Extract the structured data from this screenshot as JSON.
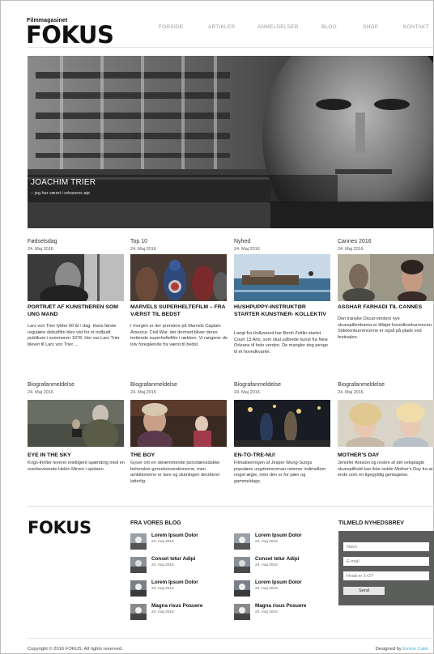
{
  "header": {
    "logo_small": "Filmmagasinet",
    "logo_big": "FOKUS",
    "nav": [
      "FORSIDE",
      "ARTIKLER",
      "ANMELDELSER",
      "BLOG",
      "SHOP",
      "KONTAKT"
    ]
  },
  "hero": {
    "title": "JOACHIM TRIER",
    "subtitle": "– jeg har været i orkanens øje"
  },
  "articles_row1": [
    {
      "category": "Fødselsdag",
      "date": "24. Maj 2016",
      "title": "PORTRÆT AF KUNSTNEREN SOM UNG MAND",
      "text": "Lars von Trier fylder 60 år i dag. Hans første regulære debutfilm blev vist for et indbudt publikum i sommeren 1978. Her var Lars Trier blevet til Lars von Trier ..."
    },
    {
      "category": "Top 10",
      "date": "24. Maj 2016",
      "title": "MARVELS SUPERHELTEFILM – FRA VÆRST TIL BEDST",
      "text": "I morgen er der premiere på Marvels Captain America: Civil War, der dermed bliver deres trettende superheltefilm i rækken. Vi rangerer de tolv foregående fra værst til bedst."
    },
    {
      "category": "Nyhed",
      "date": "24. Maj 2016",
      "title": "HUSHPUPPY-INSTRUKTØR STARTER KUNSTNER- KOLLEKTIV",
      "text": "Langt fra Hollywood har Benh Zeitlin startet Court 13 Arts, som skal udbrede kunst fra New Orleans til hele verden. De mangler dog penge til et hovedkvarter."
    },
    {
      "category": "Cannes 2016",
      "date": "24. Maj 2016",
      "title": "ASGHAR FARHADI TIL CANNES",
      "text": "Den iranske Oscar-vinders nye skuespillerdrama er tilføjet hovedkonkurrencen. Sidekonkurrencerne er også på plads ved festivalen."
    }
  ],
  "articles_row2": [
    {
      "category": "Biografanmeldelse",
      "date": "24. Maj 2016",
      "title": "EYE IN THE SKY",
      "text": "Krigs-thriller leverer intelligent spænding med en overbevisende Helen Mirren i spidsen."
    },
    {
      "category": "Biografanmeldelse",
      "date": "24. Maj 2016",
      "title": "THE BOY",
      "text": "Gyser om en skræmmende porcelænsdukke behersker genrekonventionerne, men ambitionerne er lave og slutningen decideret latterlig."
    },
    {
      "category": "Biografanmeldelse",
      "date": "24. Maj 2016",
      "title": "EN-TO-TRE-NU!",
      "text": "Filmatiseringen af Jesper Wung-Sungs populære ungdomsroman rammer indimellem noget ægte, men den er for pæn og gammeldags."
    },
    {
      "category": "Biografanmeldelse",
      "date": "24. Maj 2016",
      "title": "MOTHER'S DAY",
      "text": "Jennifer Aniston og resten af det veloplagte skuespilhold kan ikke redde Mother's Day fra at ende som en ligegyldig gentagelse."
    }
  ],
  "footer": {
    "logo": "FOKUS",
    "blog_heading": "FRA VORES BLOG",
    "blog_left": [
      {
        "title": "Lorem Ipsum Dolor",
        "date": "24. maj 2016"
      },
      {
        "title": "Conset tetur Adipi",
        "date": "24. maj 2016"
      },
      {
        "title": "Lorem Ipsum Dolor",
        "date": "24. maj 2016"
      },
      {
        "title": "Magna risus Posuere",
        "date": "24. maj 2016"
      }
    ],
    "blog_right": [
      {
        "title": "Lorem Ipsum Dolor",
        "date": "24. maj 2016"
      },
      {
        "title": "Conset tetur Adipi",
        "date": "24. maj 2016"
      },
      {
        "title": "Lorem Ipsum Dolor",
        "date": "24. maj 2016"
      },
      {
        "title": "Magna risus Posuere",
        "date": "24. maj 2016"
      }
    ],
    "newsletter_heading": "TILMELD NYHEDSBREV",
    "newsletter": {
      "name_placeholder": "Navn",
      "email_placeholder": "E-mail",
      "captcha_placeholder": "Hvad er 1+2?",
      "send_label": "Send"
    },
    "copyright": "Copyright © 2016 FOKUS. All rights reserved.",
    "designed_by": "Designed by ",
    "designer": "Emine Cakir"
  },
  "colors": {
    "accent_link": "#3fb4d9",
    "newsletter_bg": "#5b5e5b",
    "nav_text": "#9a9a9a"
  }
}
